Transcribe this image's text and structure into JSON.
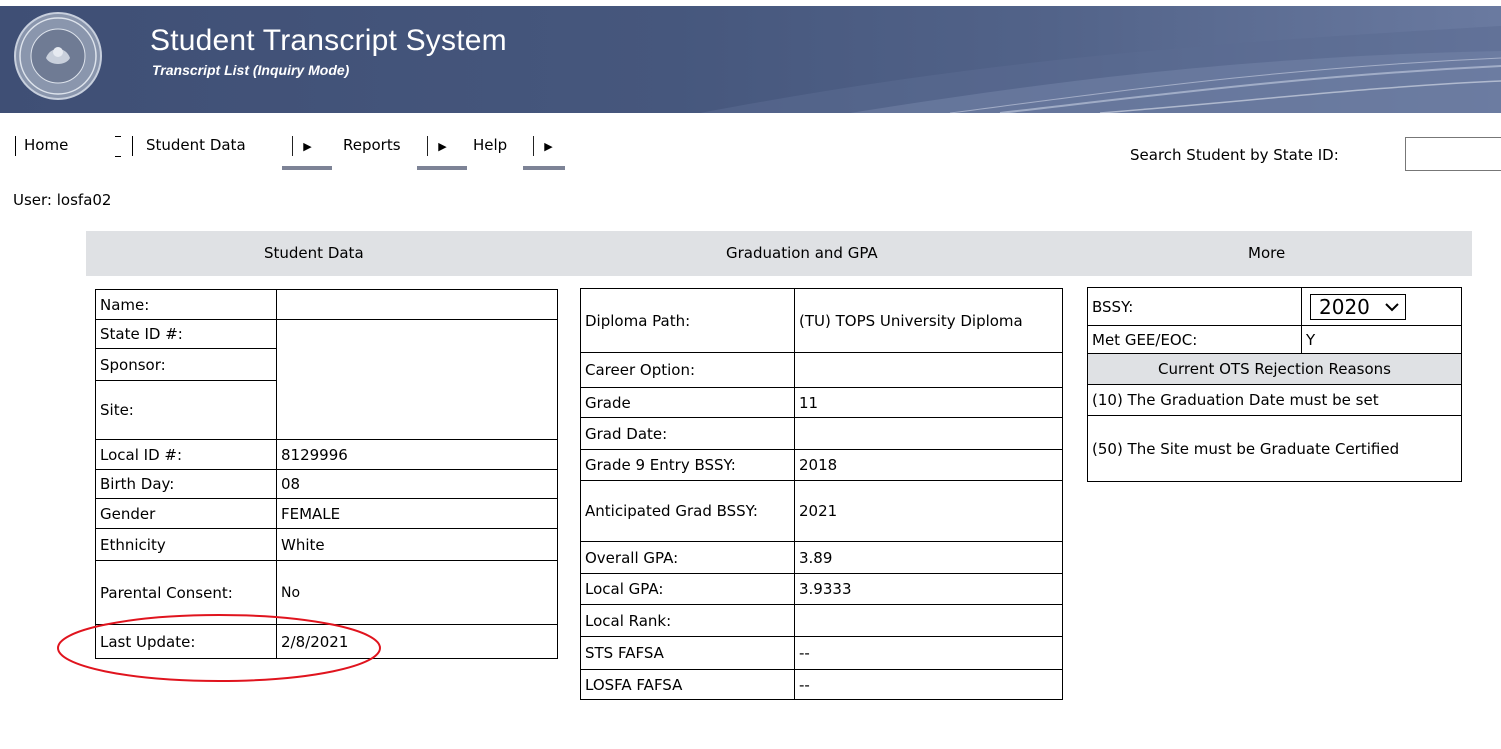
{
  "header": {
    "title": "Student Transcript System",
    "subtitle": "Transcript List (Inquiry Mode)"
  },
  "nav": {
    "items": [
      {
        "label": "Home"
      },
      {
        "label": "Student Data"
      },
      {
        "label": "Reports"
      },
      {
        "label": "Help"
      }
    ],
    "search_label": "Search Student by State ID:",
    "search_value": ""
  },
  "user": {
    "label": "User: losfa02"
  },
  "sections": {
    "student_data": "Student Data",
    "graduation_gpa": "Graduation and GPA",
    "more": "More"
  },
  "student": {
    "name_label": "Name:",
    "name_value": "",
    "state_id_label": "State ID #:",
    "sponsor_label": "Sponsor:",
    "site_label": "Site:",
    "local_id_label": "Local ID #:",
    "local_id_value": "8129996",
    "birth_day_label": "Birth Day:",
    "birth_day_value": "08",
    "gender_label": "Gender",
    "gender_value": "FEMALE",
    "ethnicity_label": "Ethnicity",
    "ethnicity_value": "White",
    "parental_consent_label": "Parental Consent:",
    "parental_consent_value": "No",
    "last_update_label": "Last Update:",
    "last_update_value": "2/8/2021"
  },
  "graduation": {
    "diploma_path_label": "Diploma Path:",
    "diploma_path_value": "(TU) TOPS University Diploma",
    "career_option_label": "Career Option:",
    "career_option_value": "",
    "grade_label": "Grade",
    "grade_value": "11",
    "grad_date_label": "Grad Date:",
    "grad_date_value": "",
    "grade9_entry_label": "Grade 9 Entry BSSY:",
    "grade9_entry_value": "2018",
    "anticipated_grad_label": "Anticipated Grad BSSY:",
    "anticipated_grad_value": "2021",
    "overall_gpa_label": "Overall GPA:",
    "overall_gpa_value": "3.89",
    "local_gpa_label": "Local GPA:",
    "local_gpa_value": "3.9333",
    "local_rank_label": "Local Rank:",
    "local_rank_value": "",
    "sts_fafsa_label": "STS FAFSA",
    "sts_fafsa_value": "--",
    "losfa_fafsa_label": "LOSFA FAFSA",
    "losfa_fafsa_value": "--"
  },
  "more": {
    "bssy_label": "BSSY:",
    "bssy_value": "2020",
    "met_gee_label": "Met GEE/EOC:",
    "met_gee_value": "Y",
    "ots_header": "Current OTS Rejection Reasons",
    "ots_reasons": [
      "(10) The Graduation Date must be set",
      "(50) The Site must be Graduate Certified"
    ]
  },
  "colors": {
    "banner": "#46577d",
    "section_bar": "#dfe1e4",
    "annotation": "#e0141e"
  },
  "icons": {
    "seal": "state-seal-icon",
    "menu_arrow": "triangle-right-icon",
    "dropdown": "chevron-down-icon"
  }
}
